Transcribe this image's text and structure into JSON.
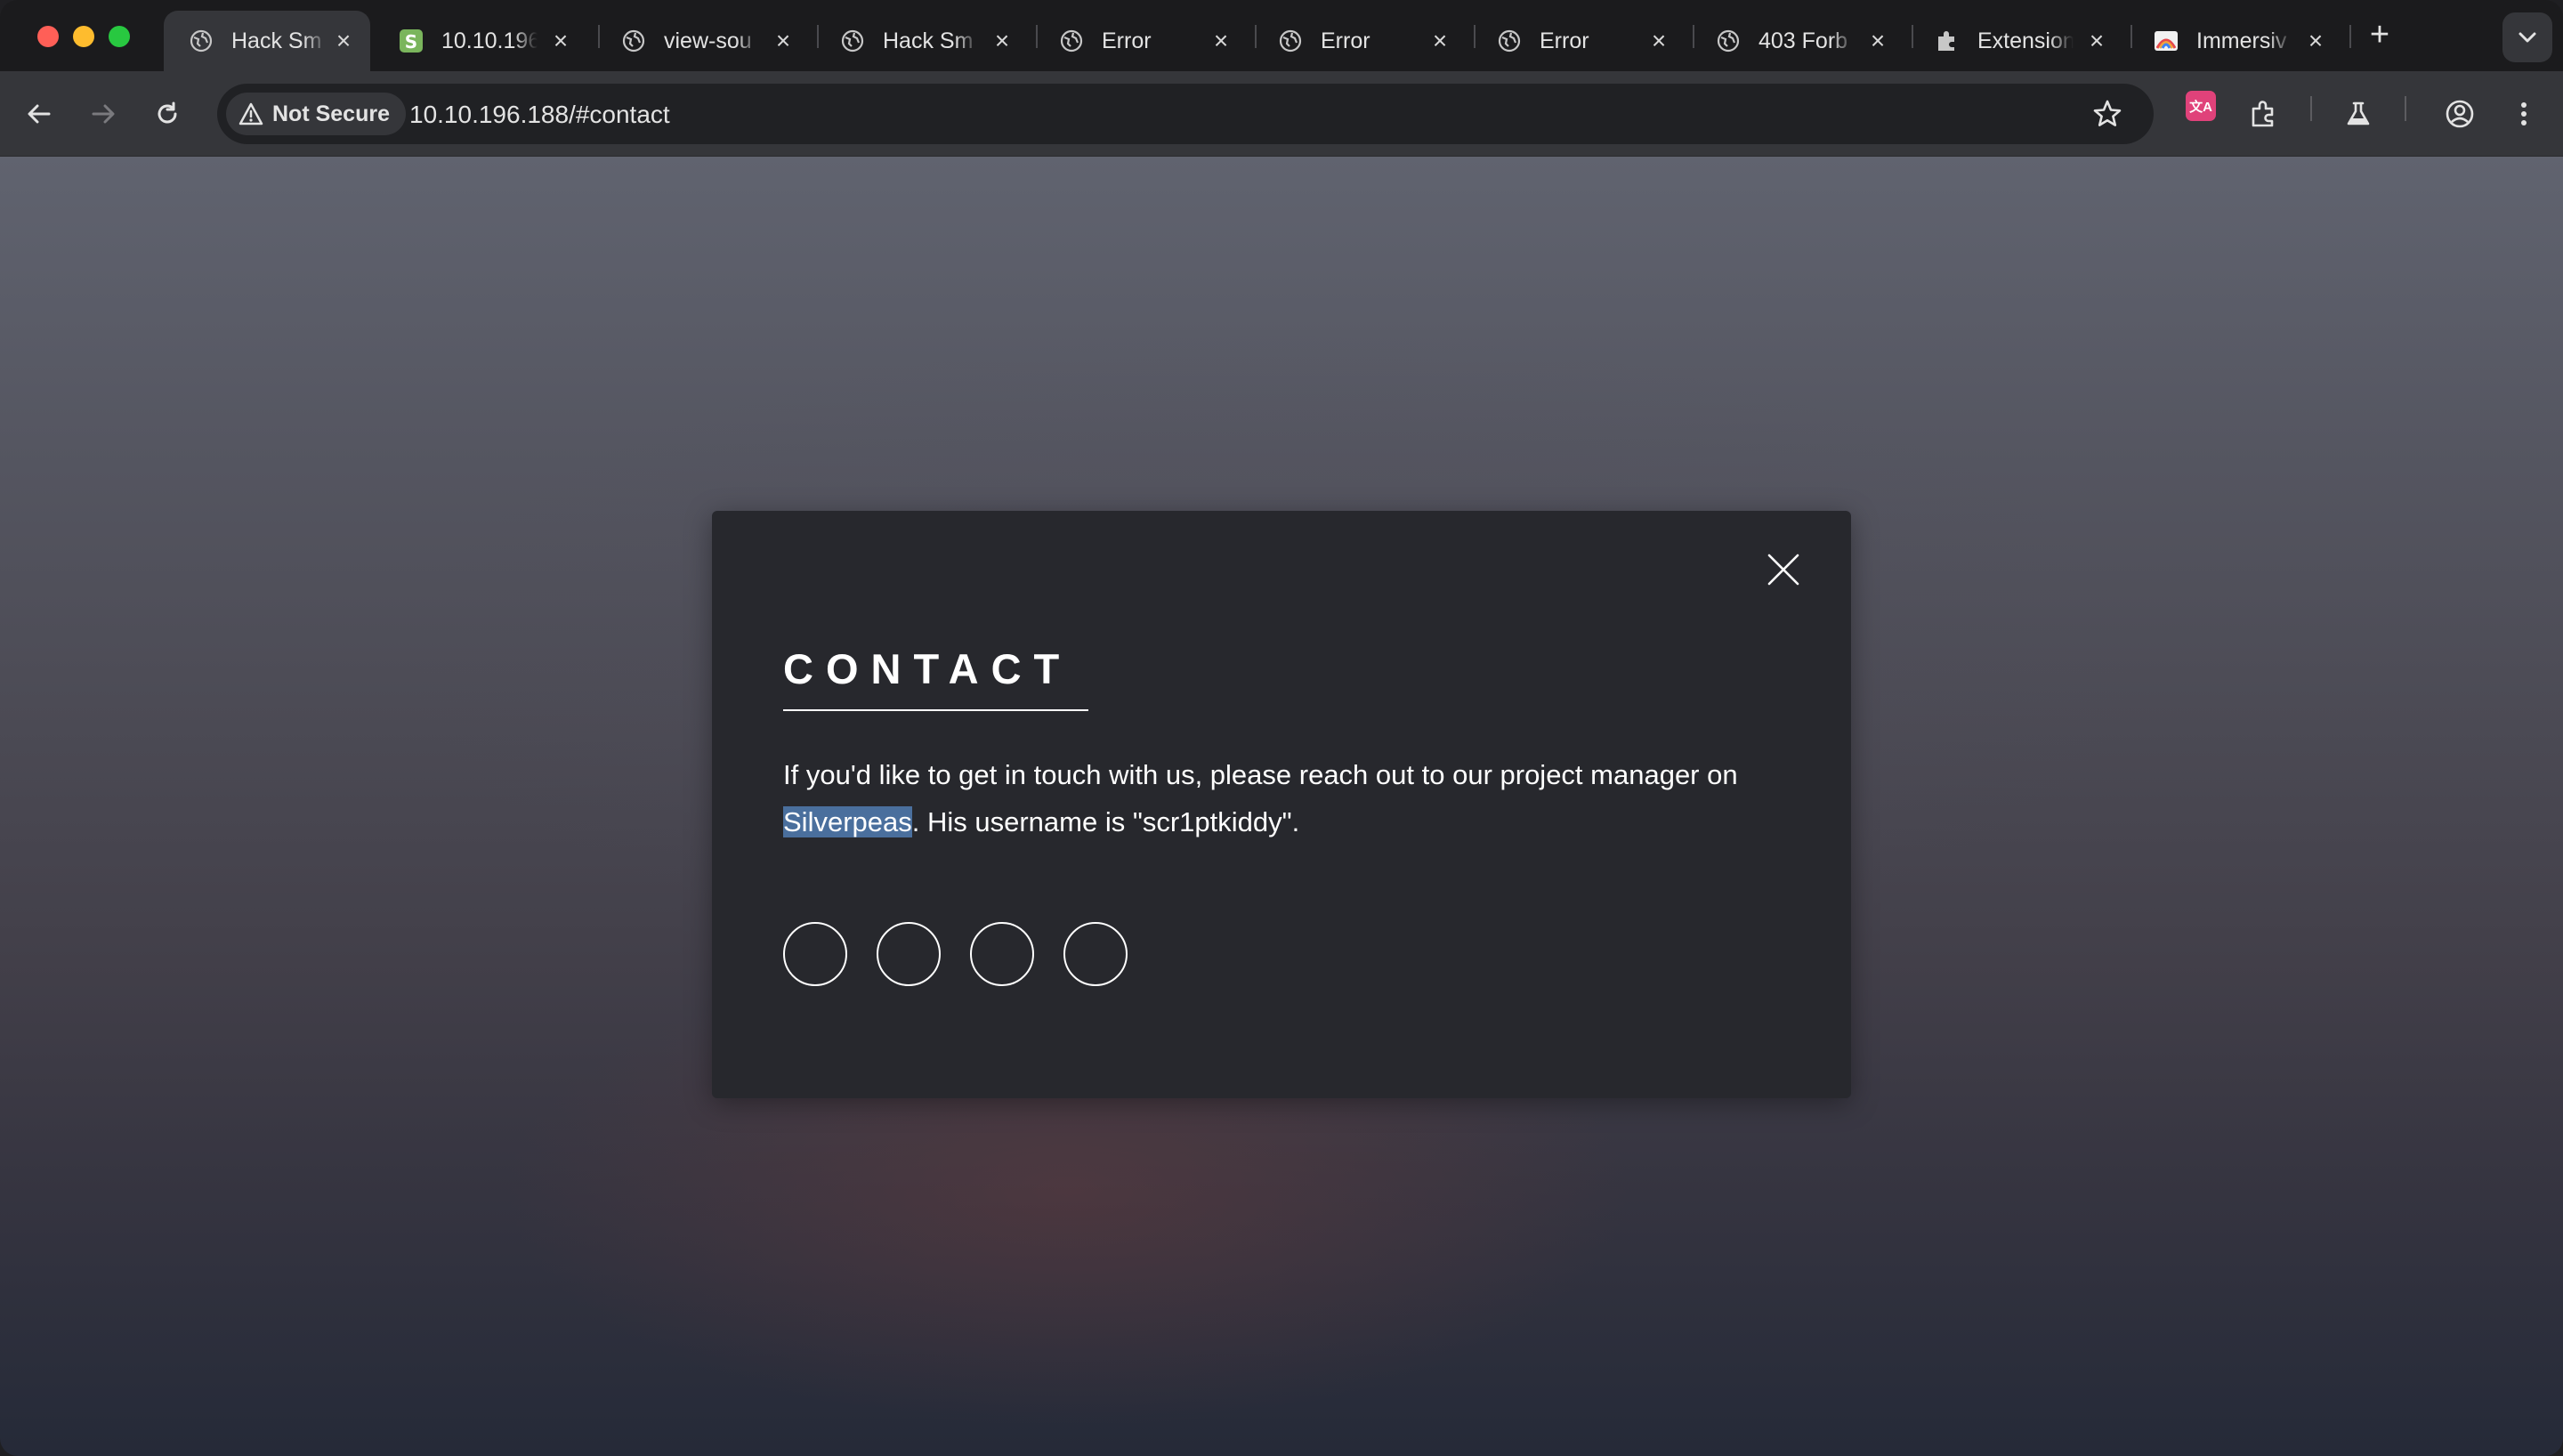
{
  "browser": {
    "tabs": [
      {
        "title": "Hack Sm",
        "favicon": "globe-icon",
        "active": true
      },
      {
        "title": "10.10.196",
        "favicon": "shopify-s-icon"
      },
      {
        "title": "view-sou",
        "favicon": "globe-icon"
      },
      {
        "title": "Hack Sm",
        "favicon": "globe-icon"
      },
      {
        "title": "Error",
        "favicon": "globe-icon"
      },
      {
        "title": "Error",
        "favicon": "globe-icon"
      },
      {
        "title": "Error",
        "favicon": "globe-icon"
      },
      {
        "title": "403 Forb",
        "favicon": "globe-icon"
      },
      {
        "title": "Extension",
        "favicon": "puzzle-icon"
      },
      {
        "title": "Immersiv",
        "favicon": "immersive-translate-icon"
      }
    ],
    "security_label": "Not Secure",
    "url": "10.10.196.188/#contact",
    "extension_badge": "文A"
  },
  "modal": {
    "heading": "CONTACT",
    "body_prefix": "If you'd like to get in touch with us, please reach out to our project manager on ",
    "body_highlight": "Silverpeas",
    "body_suffix": ". His username is \"scr1ptkiddy\".",
    "social_icons": [
      "social-circle-icon",
      "social-circle-icon",
      "social-circle-icon",
      "social-circle-icon"
    ]
  }
}
